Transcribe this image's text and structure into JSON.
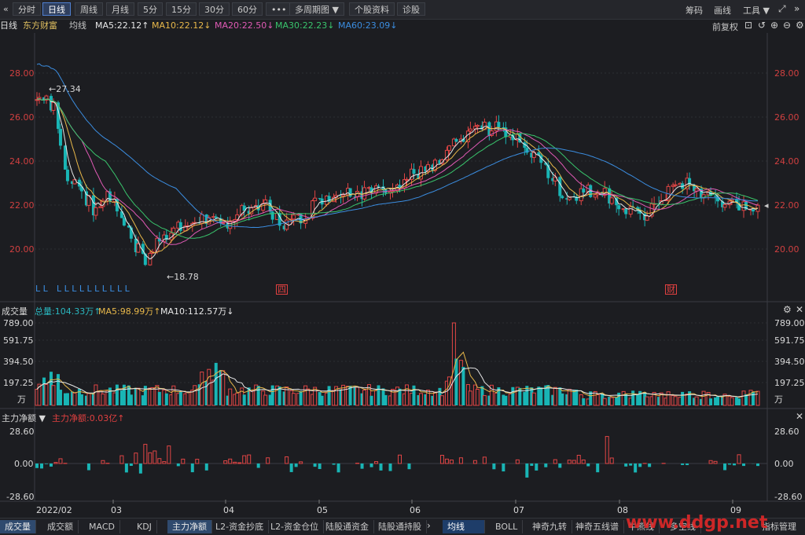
{
  "toolbar": {
    "nav_left": "«",
    "tabs": [
      "分时",
      "日线",
      "周线",
      "月线",
      "5分",
      "15分",
      "30分",
      "60分",
      "•••",
      "多周期图 ▼",
      "个股资料",
      "诊股"
    ],
    "active_tab": "日线",
    "right_items": [
      "筹码",
      "画线",
      "工具 ▼"
    ]
  },
  "main": {
    "period": "日线",
    "stock_name": "东方财富",
    "ma_label": "均线",
    "ma": [
      {
        "text": "MA5:22.12↑",
        "color": "#e8e8e8"
      },
      {
        "text": "MA10:22.12↓",
        "color": "#e8b84a"
      },
      {
        "text": "MA20:22.50↓",
        "color": "#e05ab5"
      },
      {
        "text": "MA30:22.23↓",
        "color": "#39c46c"
      },
      {
        "text": "MA60:23.09↓",
        "color": "#3b8de0"
      }
    ],
    "adjust": "前复权",
    "y_ticks": [
      "28.00",
      "26.00",
      "24.00",
      "22.00",
      "20.00"
    ],
    "high_label": "←27.34",
    "low_label": "←18.78",
    "markers": [
      "L L",
      "L L L L L L L L L L",
      "四",
      "财"
    ]
  },
  "volume": {
    "title": "成交量",
    "total": "总量:104.33万↑",
    "ma5": "MA5:98.99万↑",
    "ma10": "MA10:112.57万↓",
    "y_ticks": [
      "789.00",
      "591.75",
      "394.50",
      "197.25",
      "万"
    ]
  },
  "flow": {
    "title": "主力净额 ▼",
    "value": "主力净额:0.03亿↑",
    "y_ticks": [
      "28.60",
      "0.00",
      "-28.60"
    ]
  },
  "x_axis": [
    "2022/02",
    "03",
    "04",
    "05",
    "06",
    "07",
    "08",
    "09"
  ],
  "bottom_tabs": [
    "成交量",
    "成交额",
    "MACD",
    "KDJ",
    "主力净额",
    "L2-资金抄底",
    "L2-资金仓位",
    "陆股通资金",
    "陆股通持股"
  ],
  "bottom_right_tabs": [
    "均线",
    "BOLL",
    "神奇九转",
    "神奇五线谱",
    "牛熊线",
    "多空线",
    "指标管理"
  ],
  "watermark": "www.ddgp.net",
  "chart_data": {
    "type": "candlestick",
    "title": "东方财富 日线",
    "ylim": [
      18.5,
      29.0
    ],
    "x_labels": [
      "2022/02",
      "03",
      "04",
      "05",
      "06",
      "07",
      "08",
      "09"
    ],
    "ma_values": {
      "MA5": 22.12,
      "MA10": 22.12,
      "MA20": 22.5,
      "MA30": 22.23,
      "MA60": 23.09
    },
    "annotations": [
      {
        "text": "27.34",
        "type": "high"
      },
      {
        "text": "18.78",
        "type": "low"
      }
    ],
    "volume": {
      "unit": "万",
      "ylim": [
        0,
        789.0
      ],
      "total": 104.33,
      "ma5": 98.99,
      "ma10": 112.57
    },
    "main_net": {
      "unit": "亿",
      "ylim": [
        -28.6,
        28.6
      ],
      "value": 0.03
    }
  }
}
